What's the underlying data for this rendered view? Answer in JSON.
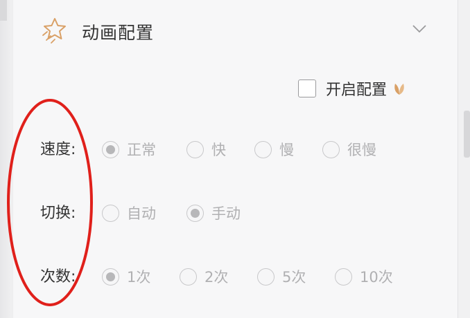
{
  "header": {
    "title": "动画配置",
    "icon": "star-sparkle-icon",
    "collapse_icon": "chevron-down-icon"
  },
  "enable": {
    "label": "开启配置",
    "checked": false,
    "badge_icon": "leaf-icon"
  },
  "rows": [
    {
      "label": "速度:",
      "options": [
        {
          "label": "正常",
          "checked": true
        },
        {
          "label": "快",
          "checked": false
        },
        {
          "label": "慢",
          "checked": false
        },
        {
          "label": "很慢",
          "checked": false
        }
      ]
    },
    {
      "label": "切换:",
      "options": [
        {
          "label": "自动",
          "checked": false
        },
        {
          "label": "手动",
          "checked": true
        }
      ]
    },
    {
      "label": "次数:",
      "options": [
        {
          "label": "1次",
          "checked": true
        },
        {
          "label": "2次",
          "checked": false
        },
        {
          "label": "5次",
          "checked": false
        },
        {
          "label": "10次",
          "checked": false
        }
      ]
    }
  ],
  "colors": {
    "accent_icon": "#d9a066",
    "annotation": "#e0201b",
    "disabled_text": "#b0b0b2"
  }
}
